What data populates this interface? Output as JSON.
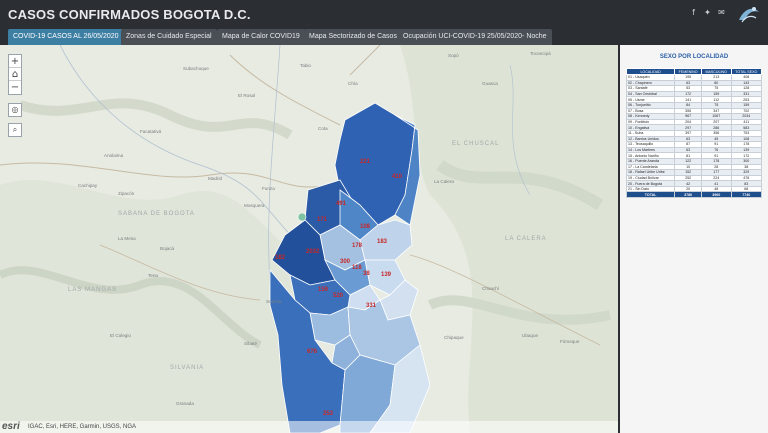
{
  "header": {
    "title": "CASOS CONFIRMADOS BOGOTA D.C.",
    "social_icons": [
      "facebook-icon",
      "twitter-icon",
      "email-icon"
    ]
  },
  "tabs": [
    {
      "label": "COVID-19 CASOS AL 26/05/2020",
      "active": true
    },
    {
      "label": "Zonas de Cuidado Especial",
      "active": false
    },
    {
      "label": "Mapa de Calor COVID19",
      "active": false
    },
    {
      "label": "Mapa Sectorizado de Casos",
      "active": false
    },
    {
      "label": "Ocupación UCI-COVID-19 25/05/2020- Noche",
      "active": false
    }
  ],
  "map": {
    "controls": {
      "zoom_in": "+",
      "zoom_out": "−"
    },
    "attribution": "IGAC, Esri, HERE, Garmin, USGS, NGA",
    "esri_logo": "esri",
    "locality_labels": [
      "221",
      "410",
      "171",
      "491",
      "108",
      "178",
      "183",
      "2032",
      "300",
      "118",
      "38",
      "139",
      "182",
      "159",
      "520",
      "331",
      "676",
      "253"
    ],
    "place_names": [
      "Tabio",
      "Chía",
      "Cota",
      "Funza",
      "Mosquera",
      "Madrid",
      "Soacha",
      "La Calera",
      "Chipaque",
      "Ubaque",
      "Sibaté",
      "Anolaima",
      "Cachipay",
      "Zipacón",
      "Bojacá",
      "El Rosal",
      "Subachoque",
      "Facatativá",
      "Tena",
      "La Mesa",
      "El Colegio",
      "Guasca",
      "Choachí",
      "Fómeque",
      "Granada",
      "Sopó",
      "Tocancipá"
    ],
    "region_labels": [
      "SABANA DE BOGOTA",
      "LA CALERA",
      "LAS MANGAS",
      "SILVANIA",
      "EL CHUSCAL"
    ]
  },
  "sidebar": {
    "title": "SEXO POR LOCALIDAD",
    "table": {
      "headers": [
        "LOCALIDAD",
        "FEMENINO",
        "MASCULINO",
        "TOTAL SEXO"
      ],
      "rows": [
        [
          "01 - Usaquén",
          "195",
          "213",
          "408"
        ],
        [
          "02 - Chapinero",
          "63",
          "80",
          "143"
        ],
        [
          "03 - Santafé",
          "53",
          "75",
          "128"
        ],
        [
          "04 - San Cristóbal",
          "172",
          "159",
          "331"
        ],
        [
          "05 - Usme",
          "141",
          "112",
          "253"
        ],
        [
          "06 - Tunjuelito",
          "84",
          "75",
          "159"
        ],
        [
          "07 - Bosa",
          "355",
          "347",
          "702"
        ],
        [
          "08 - Kennedy",
          "967",
          "1067",
          "2034"
        ],
        [
          "09 - Fontibón",
          "204",
          "207",
          "411"
        ],
        [
          "10 - Engativá",
          "297",
          "286",
          "583"
        ],
        [
          "11 - Suba",
          "397",
          "356",
          "753"
        ],
        [
          "12 - Barrios Unidos",
          "63",
          "45",
          "108"
        ],
        [
          "13 - Teusaquillo",
          "87",
          "91",
          "178"
        ],
        [
          "14 - Los Mártires",
          "63",
          "76",
          "139"
        ],
        [
          "15 - Antonio Nariño",
          "81",
          "91",
          "172"
        ],
        [
          "16 - Puente Aranda",
          "122",
          "178",
          "300"
        ],
        [
          "17 - La Candelaria",
          "10",
          "28",
          "38"
        ],
        [
          "18 - Rafael Uribe Uribe",
          "152",
          "177",
          "329"
        ],
        [
          "19 - Ciudad Bolívar",
          "252",
          "224",
          "476"
        ],
        [
          "20 - Fuera de Bogotá",
          "42",
          "41",
          "83"
        ],
        [
          "21 - Sin Dato",
          "20",
          "48",
          "68"
        ]
      ],
      "total": [
        "TOTAL",
        "3780",
        "3960",
        "7740"
      ]
    }
  }
}
